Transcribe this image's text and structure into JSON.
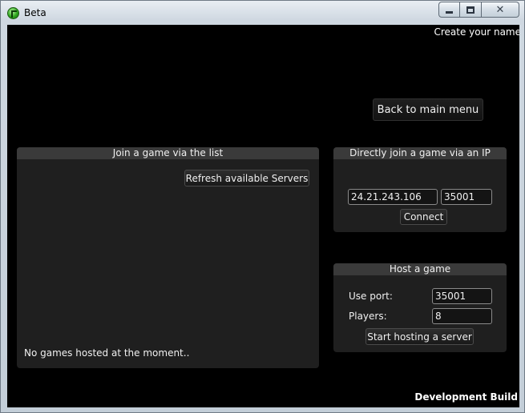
{
  "window": {
    "title": "Beta",
    "close_glyph": "✕"
  },
  "header": {
    "name_prompt": "Create your name"
  },
  "nav": {
    "back_label": "Back to main menu"
  },
  "server_list": {
    "title": "Join a game via the list",
    "refresh_label": "Refresh available Servers",
    "empty_message": "No games hosted at the moment.."
  },
  "direct_join": {
    "title": "Directly join a game via an IP",
    "ip_value": "24.21.243.106",
    "port_value": "35001",
    "connect_label": "Connect"
  },
  "host": {
    "title": "Host a game",
    "port_label": "Use port:",
    "port_value": "35001",
    "players_label": "Players:",
    "players_value": "8",
    "start_label": "Start hosting a server"
  },
  "footer": {
    "build_label": "Development Build"
  }
}
